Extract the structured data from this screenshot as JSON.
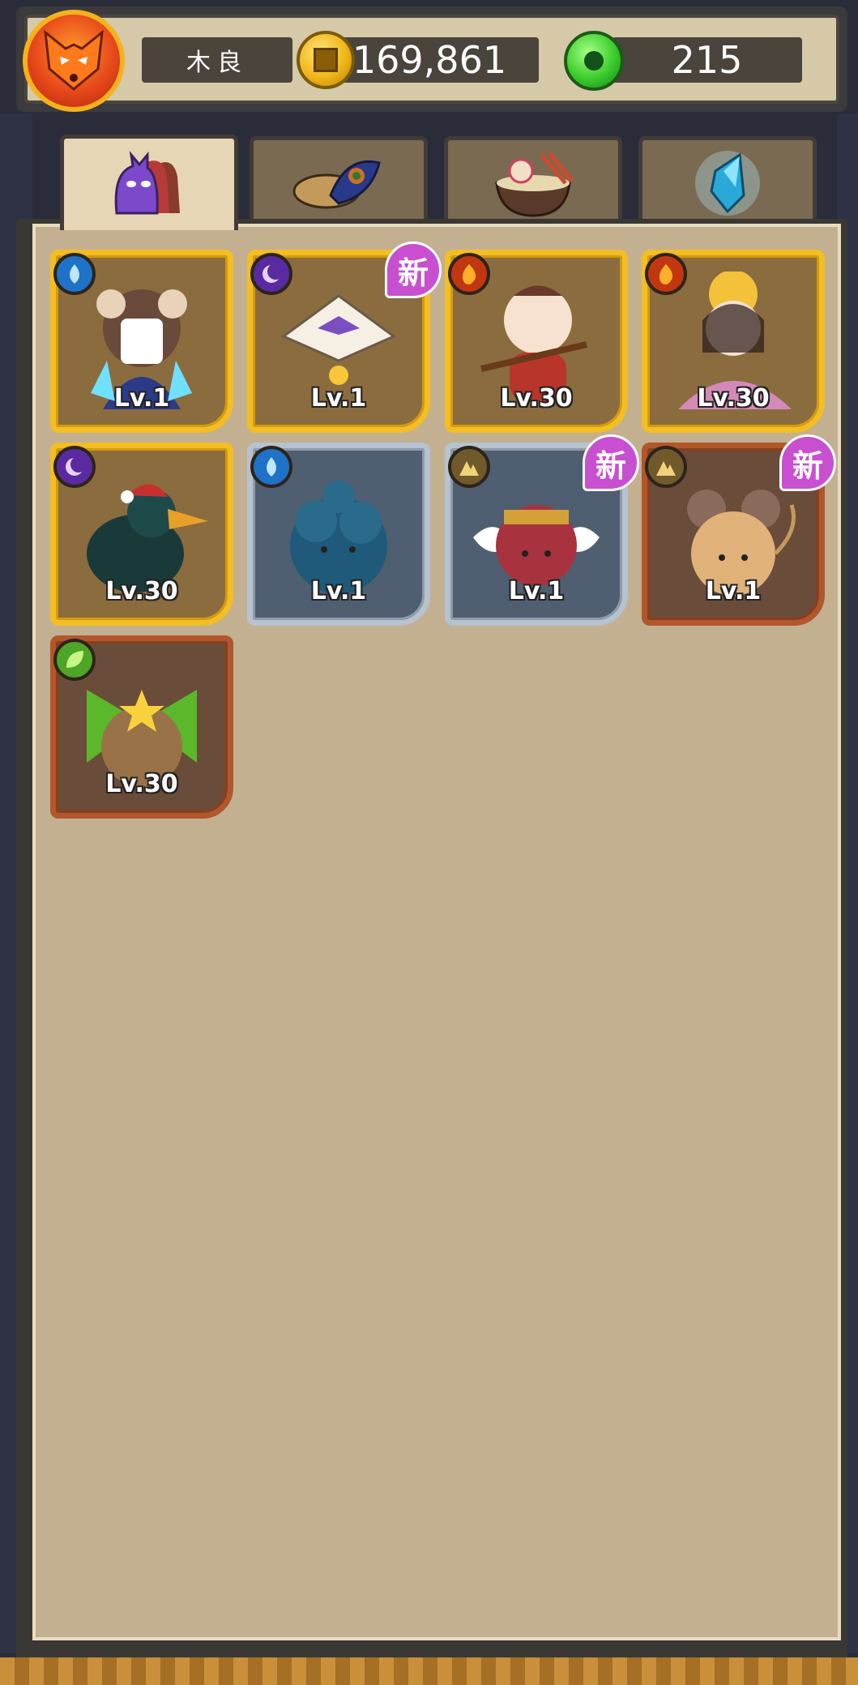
{
  "player": {
    "name": "木良",
    "coins": "169,861",
    "gems": "215"
  },
  "tabs": [
    {
      "icon": "monster-icon",
      "active": true
    },
    {
      "icon": "feather-log-icon",
      "active": false
    },
    {
      "icon": "food-bowl-icon",
      "active": false
    },
    {
      "icon": "crystal-icon",
      "active": false
    }
  ],
  "cards": [
    {
      "level": "Lv.1",
      "element": "water",
      "frame": "gold",
      "new": false,
      "character": "mouse-girl"
    },
    {
      "level": "Lv.1",
      "element": "dark",
      "frame": "gold",
      "new": true,
      "character": "bat-fan"
    },
    {
      "level": "Lv.30",
      "element": "fire",
      "frame": "gold",
      "new": false,
      "character": "flute-baby"
    },
    {
      "level": "Lv.30",
      "element": "fire",
      "frame": "gold",
      "new": false,
      "character": "empress"
    },
    {
      "level": "Lv.30",
      "element": "dark",
      "frame": "gold",
      "new": false,
      "character": "crow"
    },
    {
      "level": "Lv.1",
      "element": "water",
      "frame": "silver",
      "new": false,
      "character": "blue-fluff"
    },
    {
      "level": "Lv.1",
      "element": "earth",
      "frame": "silver",
      "new": true,
      "character": "winged-bean"
    },
    {
      "level": "Lv.1",
      "element": "earth",
      "frame": "bronze",
      "new": true,
      "character": "dough-mouse"
    },
    {
      "level": "Lv.30",
      "element": "grass",
      "frame": "bronze",
      "new": false,
      "character": "leaf-bun"
    }
  ],
  "new_badge_label": "新",
  "colors": {
    "gold_frame": "#f2be22",
    "silver_frame": "#b6c2cf",
    "bronze_frame": "#b2562c",
    "panel": "#c3b091"
  }
}
